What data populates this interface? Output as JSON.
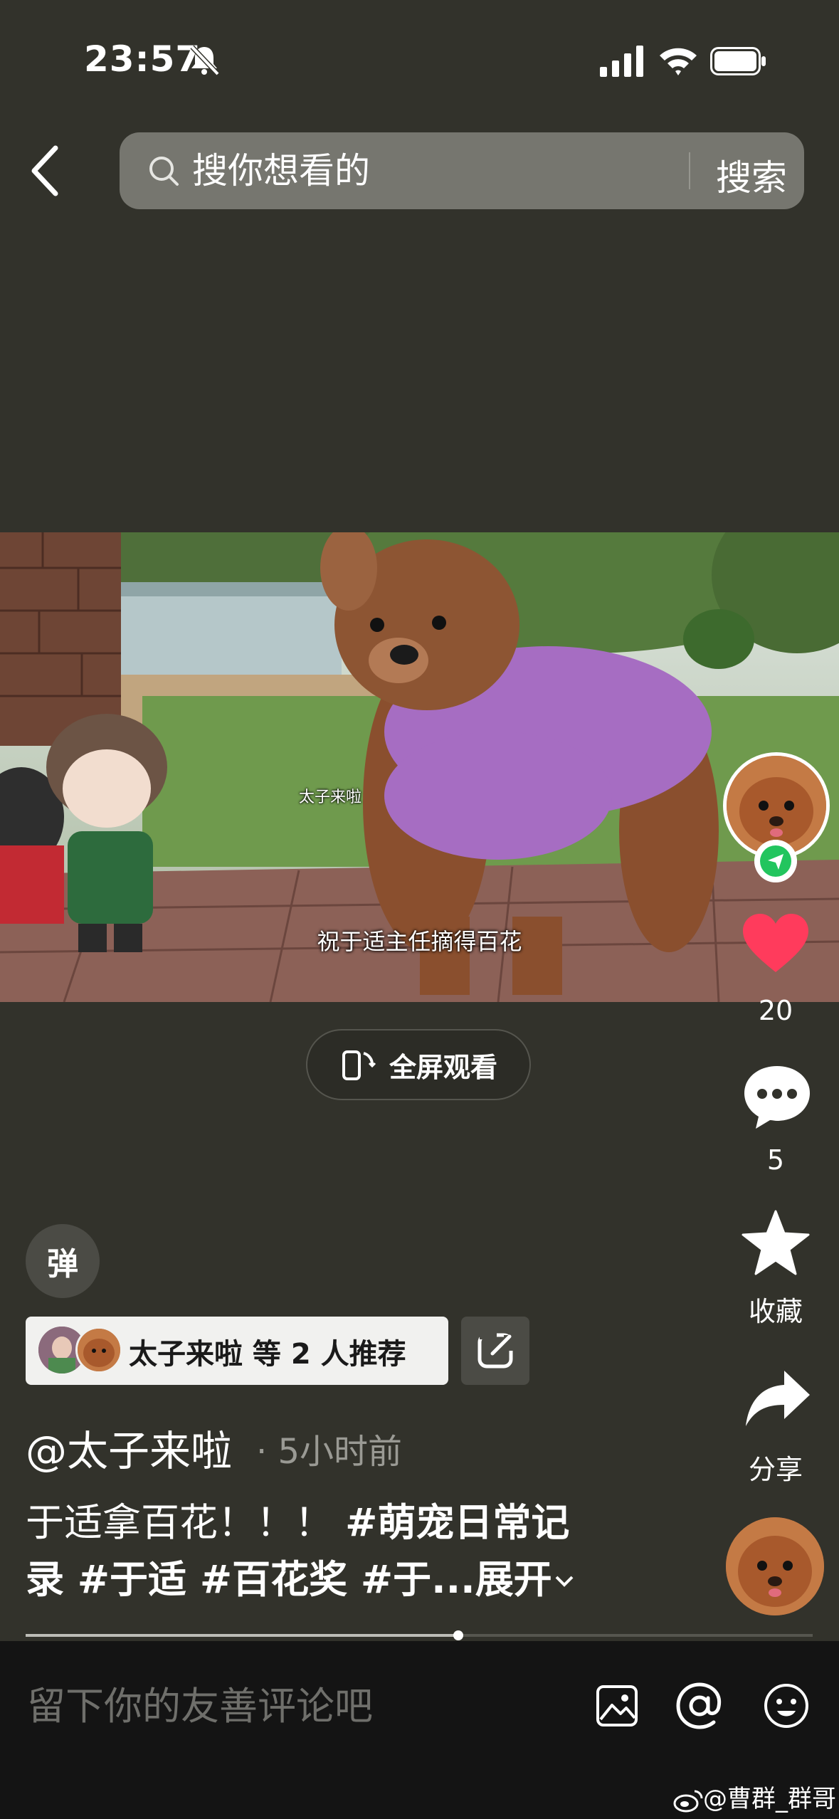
{
  "status_bar": {
    "time": "23:57"
  },
  "header": {
    "search_placeholder": "搜你想看的",
    "search_button": "搜索"
  },
  "video": {
    "subtitle_small": "太子来啦",
    "subtitle_main": "祝于适主任摘得百花",
    "fullscreen_label": "全屏观看"
  },
  "actions": {
    "like_count": "20",
    "comment_count": "5",
    "collect_label": "收藏",
    "share_label": "分享"
  },
  "post": {
    "danmu_label": "弹",
    "recommend_text": "太子来啦 等 2 人推荐",
    "author": "@太子来啦",
    "time_ago": "· 5小时前",
    "desc_line1_text": "于适拿百花！！！ ",
    "desc_line1_tag": "#萌宠日常记",
    "desc_line2_tags": "录 #于适 #百花奖 #于...",
    "expand_label": "展开",
    "progress": 0.55
  },
  "comment_bar": {
    "placeholder": "留下你的友善评论吧"
  },
  "watermark": "@曹群_群哥",
  "colors": {
    "background": "#32322b",
    "like": "#ff3b5c",
    "follow_badge": "#22c55e"
  }
}
